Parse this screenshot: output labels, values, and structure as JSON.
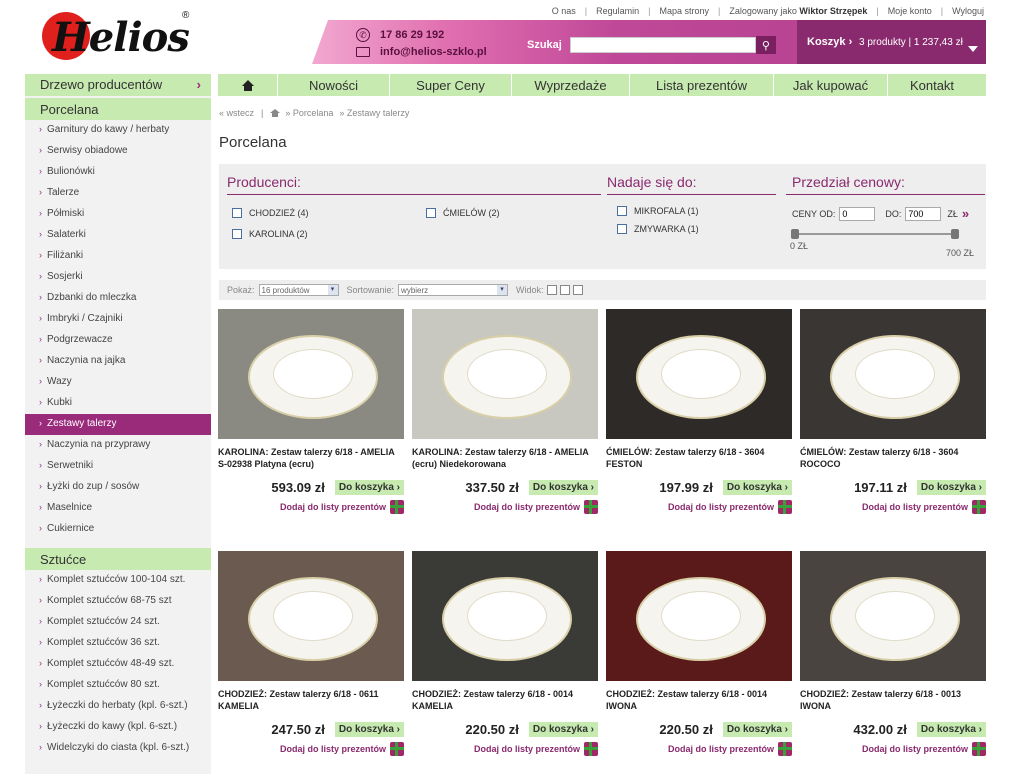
{
  "header": {
    "top_links": [
      "O nas",
      "Regulamin",
      "Mapa strony"
    ],
    "logged_prefix": "Zalogowany jako",
    "logged_user": "Wiktor Strzępek",
    "my_account": "Moje konto",
    "logout": "Wyloguj",
    "phone": "17 86 29 192",
    "email": "info@helios-szklo.pl",
    "search_label": "Szukaj",
    "search_value": "",
    "cart_label": "Koszyk ›",
    "cart_summary": "3 produkty | 1 237,43 zł",
    "logo_text": "Helios",
    "logo_reg": "®"
  },
  "nav": {
    "items": [
      "Nowości",
      "Super Ceny",
      "Wyprzedaże",
      "Lista prezentów",
      "Jak kupować",
      "Kontakt"
    ]
  },
  "sidebar": {
    "tree_title": "Drzewo producentów",
    "tree_arrow": "›",
    "cat1": "Porcelana",
    "cat1_items": [
      "Garnitury do kawy / herbaty",
      "Serwisy obiadowe",
      "Bulionówki",
      "Talerze",
      "Półmiski",
      "Salaterki",
      "Filiżanki",
      "Sosjerki",
      "Dzbanki do mleczka",
      "Imbryki / Czajniki",
      "Podgrzewacze",
      "Naczynia na jajka",
      "Wazy",
      "Kubki",
      "Zestawy talerzy",
      "Naczynia na przyprawy",
      "Serwetniki",
      "Łyżki do zup / sosów",
      "Maselnice",
      "Cukiernice"
    ],
    "active_index": 14,
    "cat2": "Sztućce",
    "cat2_items": [
      "Komplet sztućców 100-104 szt.",
      "Komplet sztućców 68-75 szt",
      "Komplet sztućców 24 szt.",
      "Komplet sztućców 36 szt.",
      "Komplet sztućców 48-49 szt.",
      "Komplet sztućców 80 szt.",
      "Łyżeczki do herbaty (kpl. 6-szt.)",
      "Łyżeczki do kawy (kpl. 6-szt.)",
      "Widelczyki do ciasta (kpl. 6-szt.)"
    ]
  },
  "breadcrumbs": {
    "back": "« wstecz",
    "items": [
      "» Porcelana",
      "» Zestawy talerzy"
    ]
  },
  "page_title": "Porcelana",
  "filters": {
    "producers_title": "Producenci:",
    "producers": [
      "CHODZIEŻ (4)",
      "ĆMIELÓW (2)",
      "KAROLINA (2)"
    ],
    "suitable_title": "Nadaje się do:",
    "suitable": [
      "MIKROFALA (1)",
      "ZMYWARKA (1)"
    ],
    "price_title": "Przedział cenowy:",
    "price_from_label": "CENY OD:",
    "price_from": "0",
    "price_to_label": "DO:",
    "price_to": "700",
    "price_unit": "ZŁ",
    "go": "»",
    "slider_min": "0 ZŁ",
    "slider_max": "700 ZŁ"
  },
  "toolbar": {
    "show_label": "Pokaż:",
    "show_value": "16 produktów",
    "sort_label": "Sortowanie:",
    "sort_value": "wybierz",
    "view_label": "Widok:"
  },
  "products": [
    {
      "name": "KAROLINA: Zestaw talerzy 6/18 - AMELIA S-02938 Platyna (ecru)",
      "price": "593.09 zł",
      "bg": "#8a8a82"
    },
    {
      "name": "KAROLINA: Zestaw talerzy 6/18 - AMELIA (ecru) Niedekorowana",
      "price": "337.50 zł",
      "bg": "#c8c8c0"
    },
    {
      "name": "ĆMIELÓW: Zestaw talerzy 6/18 - 3604 FESTON",
      "price": "197.99 zł",
      "bg": "#2e2a28"
    },
    {
      "name": "ĆMIELÓW: Zestaw talerzy 6/18 - 3604 ROCOCO",
      "price": "197.11 zł",
      "bg": "#3a3634"
    },
    {
      "name": "CHODZIEŻ: Zestaw talerzy 6/18 - 0611 KAMELIA",
      "price": "247.50 zł",
      "bg": "#6a5a50"
    },
    {
      "name": "CHODZIEŻ: Zestaw talerzy 6/18 - 0014 KAMELIA",
      "price": "220.50 zł",
      "bg": "#3a3a36"
    },
    {
      "name": "CHODZIEŻ: Zestaw talerzy 6/18 - 0014 IWONA",
      "price": "220.50 zł",
      "bg": "#5a1a1a"
    },
    {
      "name": "CHODZIEŻ: Zestaw talerzy 6/18 - 0013 IWONA",
      "price": "432.00 zł",
      "bg": "#4a4440"
    }
  ],
  "buy_label": "Do koszyka ›",
  "gift_label": "Dodaj do listy prezentów"
}
